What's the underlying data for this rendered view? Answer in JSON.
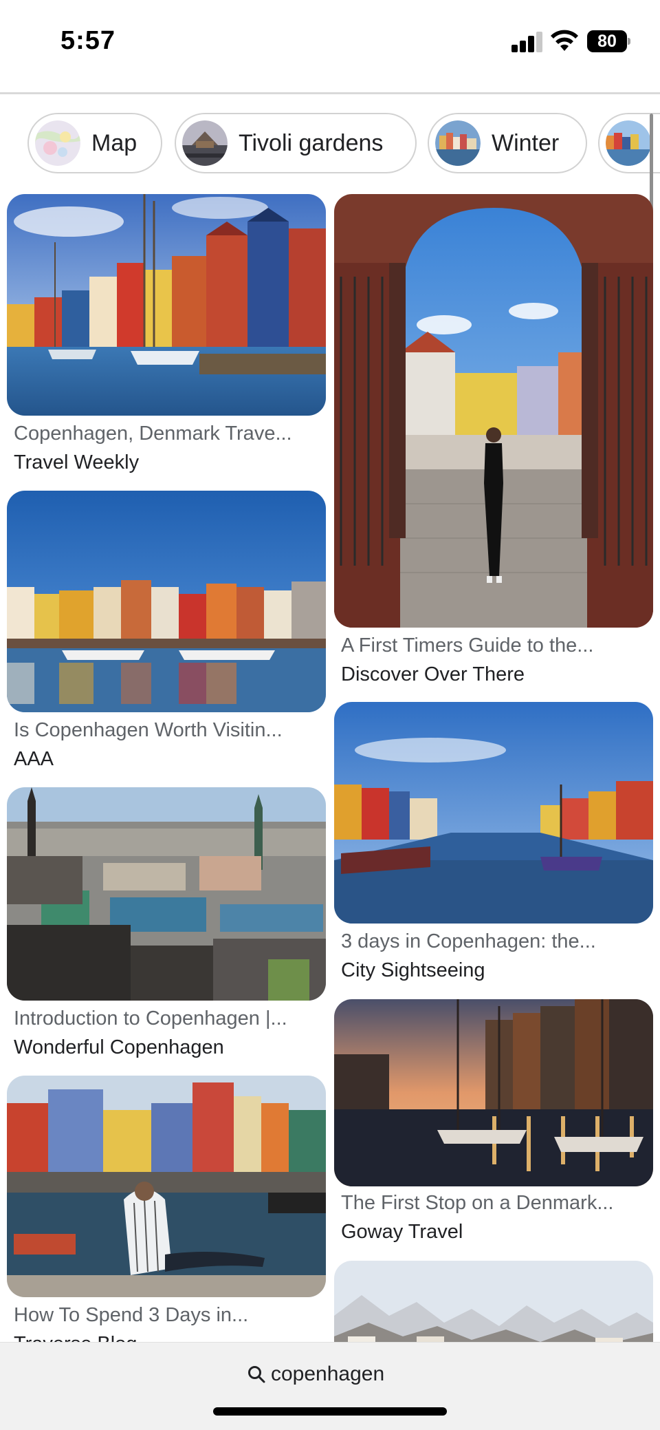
{
  "status": {
    "time": "5:57",
    "battery": "80"
  },
  "chips": [
    {
      "label": "Map",
      "icon": "map-thumbnail"
    },
    {
      "label": "Tivoli gardens",
      "icon": "tivoli-thumbnail"
    },
    {
      "label": "Winter",
      "icon": "winter-thumbnail"
    },
    {
      "label": "",
      "icon": "nyhavn-thumbnail"
    }
  ],
  "results": {
    "left": [
      {
        "title": "Copenhagen, Denmark Trave...",
        "source": "Travel Weekly"
      },
      {
        "title": "Is Copenhagen Worth Visitin...",
        "source": "AAA"
      },
      {
        "title": "Introduction to Copenhagen |...",
        "source": "Wonderful Copenhagen"
      },
      {
        "title": "How To Spend 3 Days in...",
        "source": "Traverse Blog"
      }
    ],
    "right": [
      {
        "title": "A First Timers Guide to the...",
        "source": "Discover Over There"
      },
      {
        "title": "3 days in Copenhagen: the...",
        "source": "City Sightseeing"
      },
      {
        "title": "The First Stop on a Denmark...",
        "source": "Goway Travel"
      },
      {
        "title": "",
        "source": ""
      }
    ]
  },
  "search": {
    "query": "copenhagen",
    "icon": "search-icon"
  },
  "colors": {
    "chip_border": "#d2d2d2",
    "title_text": "#5f6368",
    "source_text": "#202124"
  }
}
